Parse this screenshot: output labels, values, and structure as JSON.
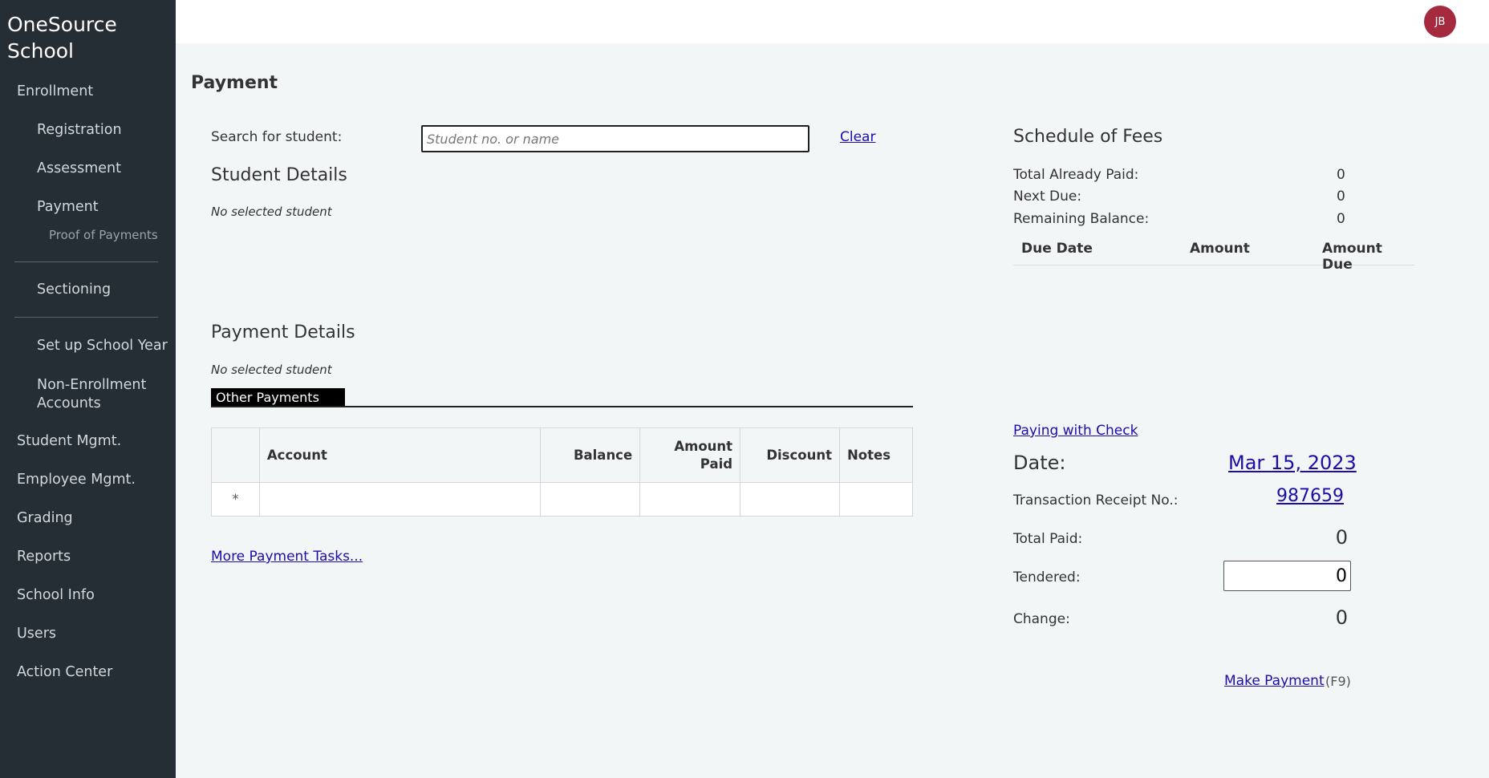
{
  "app": {
    "brand": "OneSource School"
  },
  "sidebar": {
    "enrollment": "Enrollment",
    "registration": "Registration",
    "assessment": "Assessment",
    "payment": "Payment",
    "proof_of_payments": "Proof of Payments",
    "sectioning": "Sectioning",
    "setup_school_year": "Set up School Year",
    "non_enrollment_accounts": "Non-Enrollment Accounts",
    "student_mgmt": "Student Mgmt.",
    "employee_mgmt": "Employee Mgmt.",
    "grading": "Grading",
    "reports": "Reports",
    "school_info": "School Info",
    "users": "Users",
    "action_center": "Action Center"
  },
  "header": {
    "avatar_initials": "JB"
  },
  "page": {
    "title": "Payment"
  },
  "search": {
    "label": "Search for student:",
    "placeholder": "Student no. or name",
    "value": "",
    "clear_label": "Clear"
  },
  "student_details": {
    "title": "Student Details",
    "empty_text": "No selected student"
  },
  "payment_details": {
    "title": "Payment Details",
    "empty_text": "No selected student",
    "active_tab": "Other Payments",
    "table": {
      "columns": {
        "account": "Account",
        "balance": "Balance",
        "amount_paid": "Amount Paid",
        "discount": "Discount",
        "notes": "Notes"
      },
      "new_row_marker": "*"
    },
    "more_tasks_label": "More Payment Tasks..."
  },
  "schedule_of_fees": {
    "title": "Schedule of Fees",
    "total_already_paid_label": "Total Already Paid:",
    "total_already_paid": "0",
    "next_due_label": "Next Due:",
    "next_due": "0",
    "remaining_balance_label": "Remaining Balance:",
    "remaining_balance": "0",
    "columns": {
      "due_date": "Due Date",
      "amount": "Amount",
      "amount_due": "Amount Due"
    }
  },
  "transaction": {
    "paying_with_check_label": "Paying with Check",
    "date_label": "Date:",
    "date_value": "Mar 15, 2023",
    "receipt_label": "Transaction Receipt No.:",
    "receipt_value": "987659",
    "total_paid_label": "Total Paid:",
    "total_paid": "0",
    "tendered_label": "Tendered:",
    "tendered_value": "0",
    "change_label": "Change:",
    "change_value": "0",
    "make_payment_label": "Make Payment",
    "make_payment_shortcut": "(F9)"
  }
}
